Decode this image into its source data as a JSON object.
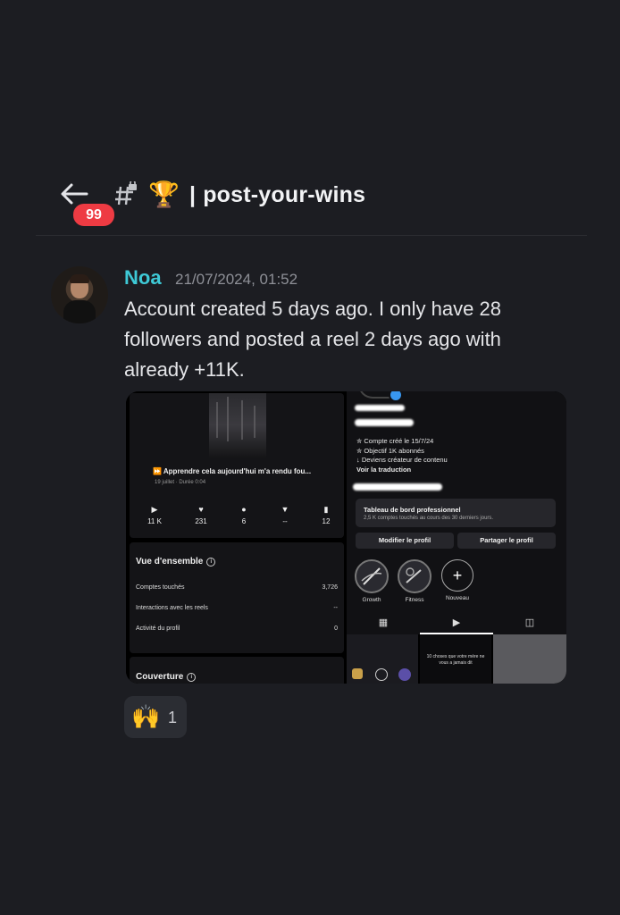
{
  "header": {
    "back_icon": "arrow-left-icon",
    "unread_badge": "99",
    "channel_icon": "hash-lock-icon",
    "trophy_emoji": "🏆",
    "separator": "|",
    "channel_name": "post-your-wins"
  },
  "message": {
    "author": "Noa",
    "timestamp": "21/07/2024, 01:52",
    "text": "Account created 5 days ago. I only have 28 followers and posted a reel 2 days ago with already +11K.",
    "colors": {
      "author": "#3ec9d6",
      "badge": "#ee3b43"
    }
  },
  "attachment": {
    "left": {
      "reel_title": "Apprendre cela aujourd'hui m'a rendu fou...",
      "reel_subtitle": "19 juillet · Durée 0:04",
      "stats": [
        {
          "icon": "play-icon",
          "glyph": "▶",
          "value": "11 K"
        },
        {
          "icon": "heart-icon",
          "glyph": "♥",
          "value": "231"
        },
        {
          "icon": "comment-icon",
          "glyph": "●",
          "value": "6"
        },
        {
          "icon": "share-icon",
          "glyph": "▼",
          "value": "--"
        },
        {
          "icon": "bookmark-icon",
          "glyph": "▮",
          "value": "12"
        }
      ],
      "overview_title": "Vue d'ensemble",
      "overview_rows": [
        {
          "label": "Comptes touchés",
          "value": "3,726"
        },
        {
          "label": "Interactions avec les reels",
          "value": "--"
        },
        {
          "label": "Activité du profil",
          "value": "0"
        }
      ],
      "coverage_title": "Couverture"
    },
    "right": {
      "bio_lines": [
        "✮ Compte créé le 15/7/24",
        "✮ Objectif 1K abonnés",
        "↓ Deviens créateur de contenu"
      ],
      "translate_link": "Voir la traduction",
      "dashboard_title": "Tableau de bord professionnel",
      "dashboard_sub": "2,5 K comptes touchés au cours des 30 derniers jours.",
      "edit_button": "Modifier le profil",
      "share_button": "Partager le profil",
      "highlights": [
        "Growth",
        "Fitness",
        "Nouveau"
      ],
      "grid_texts": [
        "10 choses que votre mère ne vous a jamais dit"
      ]
    }
  },
  "reaction": {
    "emoji": "🙌",
    "count": "1"
  }
}
